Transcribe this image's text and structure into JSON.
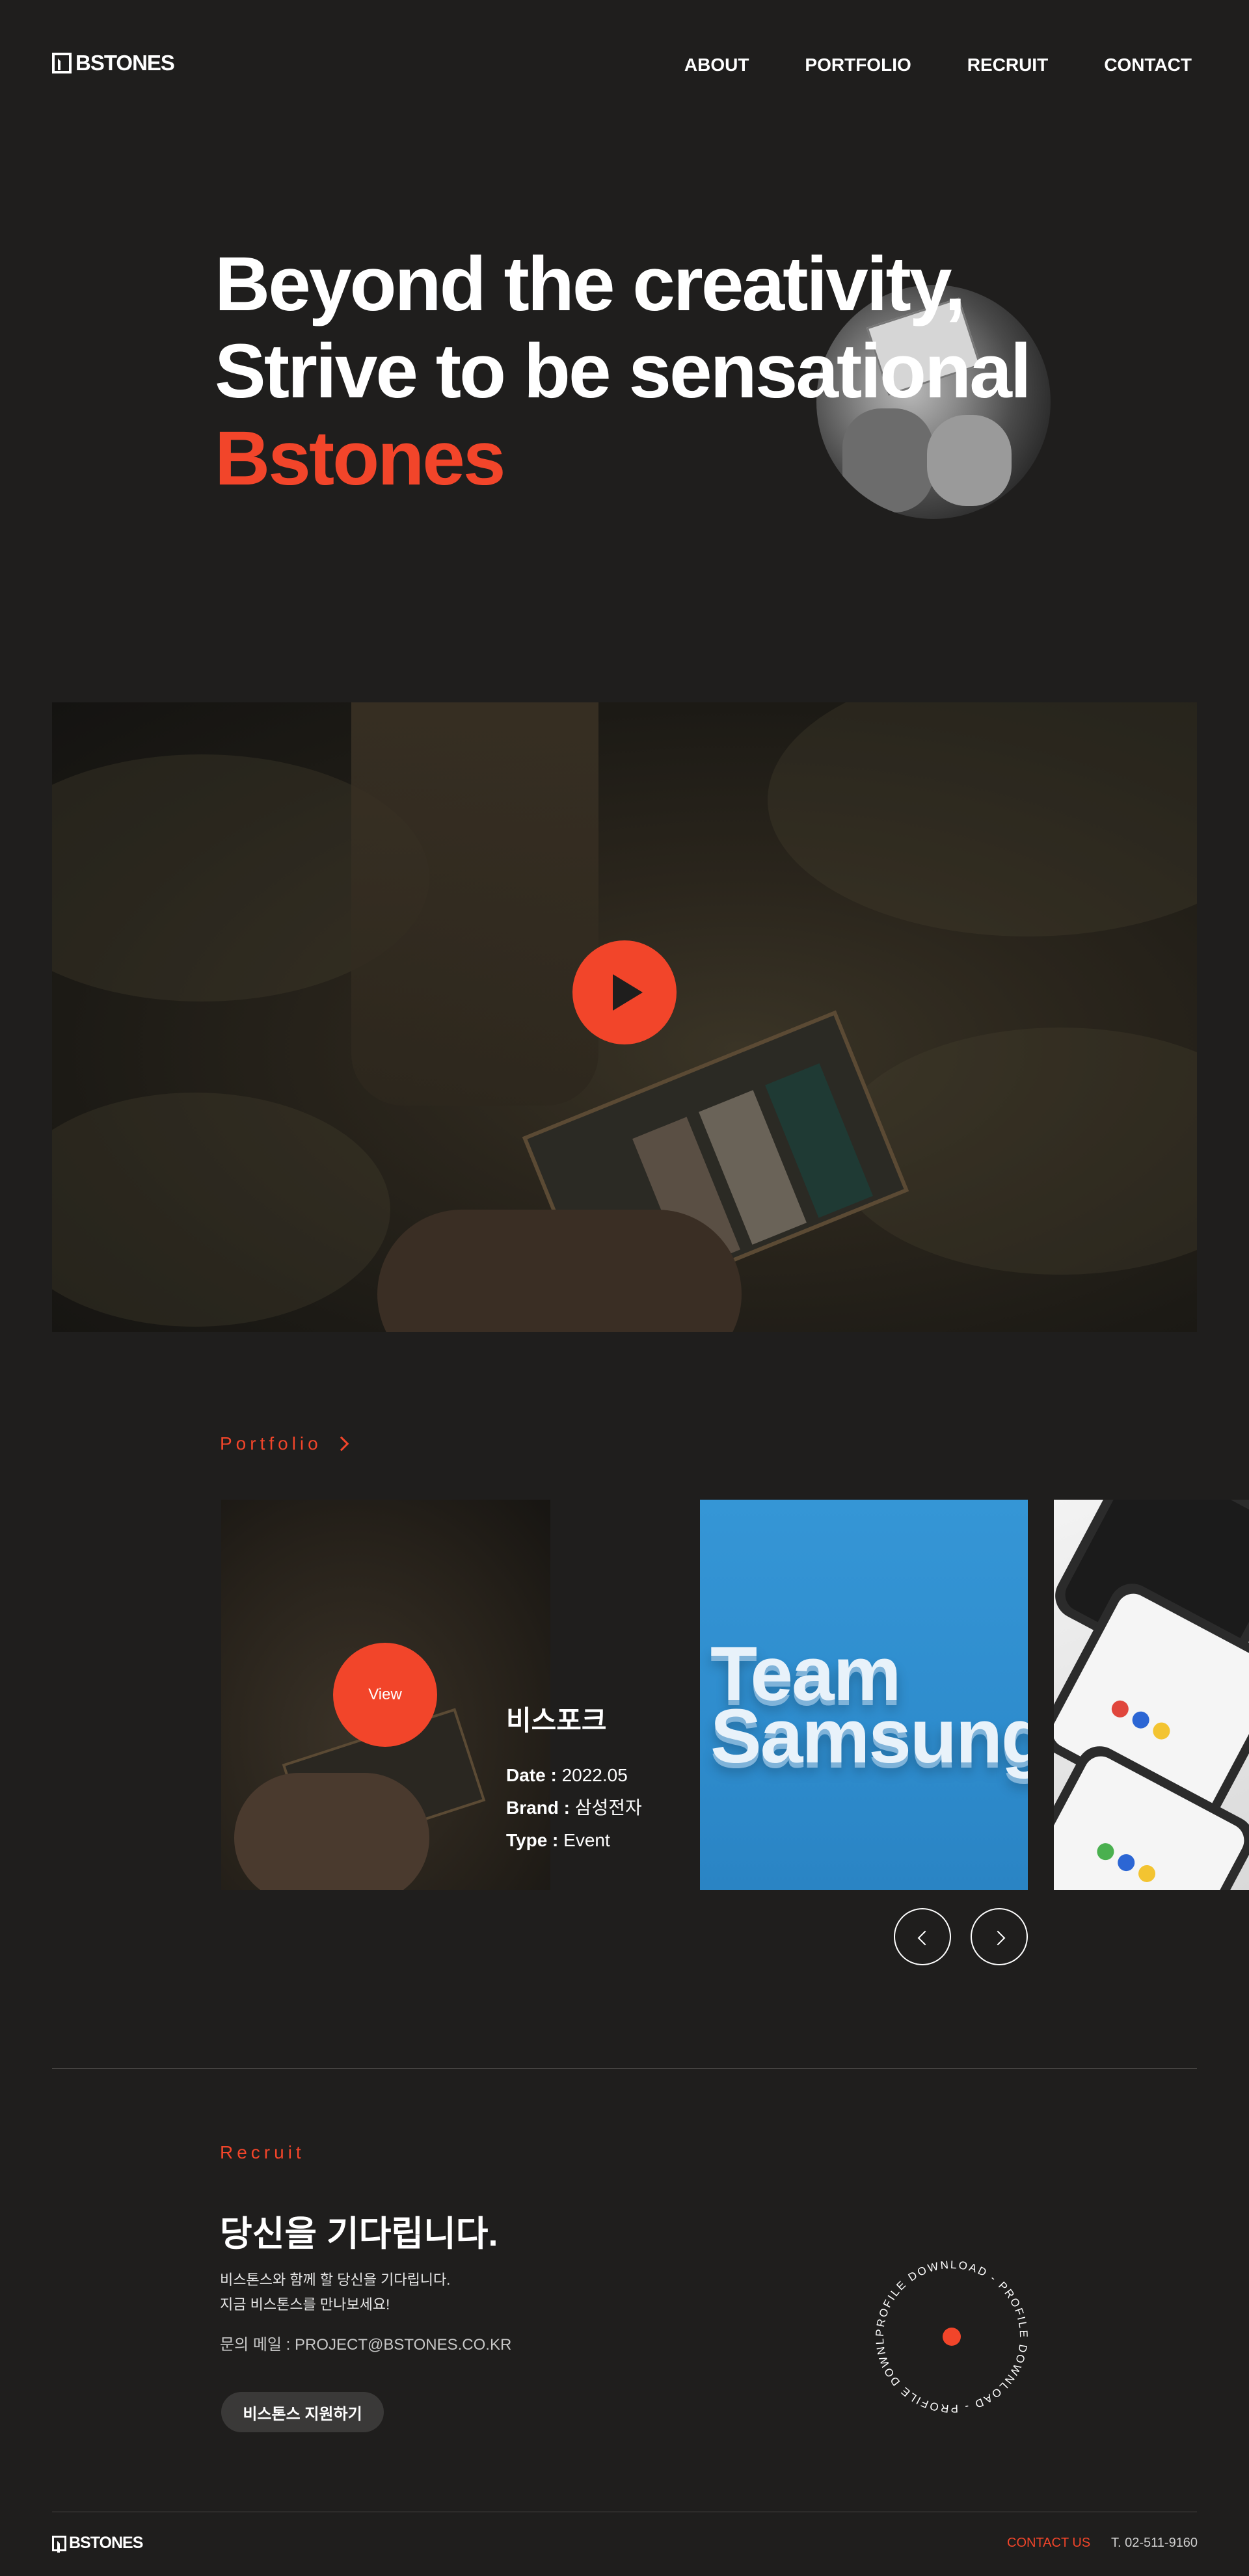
{
  "header": {
    "logo_text": "BSTONES",
    "nav": [
      "ABOUT",
      "PORTFOLIO",
      "RECRUIT",
      "CONTACT"
    ]
  },
  "hero": {
    "line1": "Beyond the creativity,",
    "line2": "Strive to be sensational",
    "line3": "Bstones"
  },
  "video": {
    "play_icon": "play-icon"
  },
  "portfolio": {
    "heading": "Portfolio",
    "featured": {
      "view_label": "View",
      "title": "비스포크",
      "date_label": "Date :",
      "date": "2022.05",
      "brand_label": "Brand :",
      "brand": "삼성전자",
      "type_label": "Type :",
      "type": "Event"
    },
    "card2_text": [
      "Team",
      "Samsung"
    ]
  },
  "recruit": {
    "label": "Recruit",
    "title": "당신을 기다립니다.",
    "desc_line1": "비스톤스와 함께 할 당신을 기다립니다.",
    "desc_line2": "지금 비스톤스를 만나보세요!",
    "email_label": "문의 메일 :",
    "email": "PROJECT@BSTONES.CO.KR",
    "apply_button": "비스톤스 지원하기",
    "profile_download": "PROFILE DOWNLOAD - PROFILE DOWNLOAD - PROFILE DOWNLOAD -"
  },
  "footer": {
    "logo_text": "BSTONES",
    "contact_link": "CONTACT US",
    "phone": "T. 02-511-9160"
  },
  "colors": {
    "background": "#1f1e1d",
    "accent": "#f2452a",
    "text": "#ffffff"
  }
}
